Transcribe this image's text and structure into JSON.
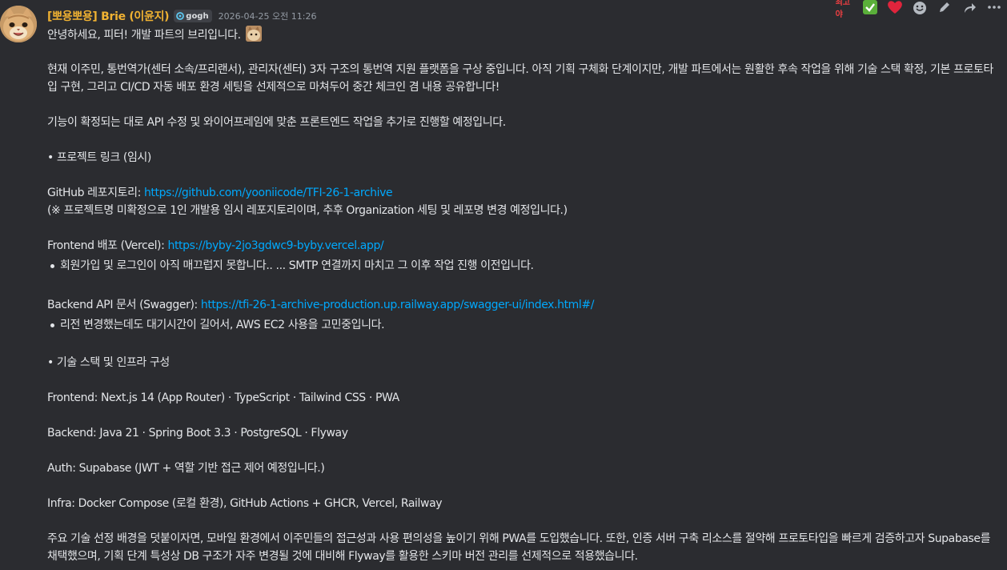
{
  "message": {
    "username": "[뽀용뽀용] Brie (이윤지)",
    "tag": "gogh",
    "timestamp": "2026-04-25 오전 11:26"
  },
  "toolbar": {
    "quick_react_text": "최고야",
    "icons": [
      "check-emoji",
      "heart-emoji",
      "add-reaction-icon",
      "edit-icon",
      "forward-icon",
      "more-icon"
    ]
  },
  "content": {
    "greeting": "안녕하세요, 피터! 개발 파트의 브리입니다.",
    "intro": "현재 이주민, 통번역가(센터 소속/프리랜서), 관리자(센터) 3자 구조의 통번역 지원 플랫폼을 구상 중입니다. 아직 기획 구체화 단계이지만, 개발 파트에서는 원활한 후속 작업을 위해 기술 스택 확정, 기본 프로토타입 구현, 그리고 CI/CD 자동 배포 환경 세팅을 선제적으로 마쳐두어 중간 체크인 겸 내용 공유합니다!",
    "plan": "기능이 확정되는 대로 API 수정 및 와이어프레임에 맞춘 프론트엔드 작업을 추가로 진행할 예정입니다.",
    "links_heading": "• 프로젝트 링크 (임시)",
    "github_label": "GitHub 레포지토리: ",
    "github_url": "https://github.com/yooniicode/TFI-26-1-archive",
    "github_note": "(※ 프로젝트명 미확정으로 1인 개발용 임시 레포지토리이며, 추후 Organization 세팅 및 레포명 변경 예정입니다.)",
    "frontend_label": "Frontend 배포 (Vercel): ",
    "frontend_url": "https://byby-2jo3gdwc9-byby.vercel.app/",
    "frontend_note": "회원가입 및 로그인이 아직 매끄럽지 못합니다.. ... SMTP 연결까지 마치고 그 이후 작업 진행 이전입니다.",
    "backend_label": "Backend API 문서 (Swagger): ",
    "backend_url": "https://tfi-26-1-archive-production.up.railway.app/swagger-ui/index.html#/",
    "backend_note": "리전 변경했는데도 대기시간이 길어서, AWS EC2 사용을 고민중입니다.",
    "stack_heading": "• 기술 스택 및 인프라 구성",
    "stack_frontend": "Frontend: Next.js 14 (App Router) · TypeScript · Tailwind CSS · PWA",
    "stack_backend": "Backend: Java 21 · Spring Boot 3.3 · PostgreSQL · Flyway",
    "stack_auth": "Auth: Supabase (JWT + 역할 기반 접근 제어 예정입니다.)",
    "stack_infra": "Infra: Docker Compose (로컬 환경), GitHub Actions + GHCR, Vercel, Railway",
    "rationale": "주요 기술 선정 배경을 덧붙이자면, 모바일 환경에서 이주민들의 접근성과 사용 편의성을 높이기 위해 PWA를 도입했습니다. 또한, 인증 서버 구축 리소스를 절약해 프로토타입을 빠르게 검증하고자 Supabase를 채택했으며, 기획 단계 특성상 DB 구조가 자주 변경될 것에 대비해 Flyway를 활용한 스키마 버전 관리를 선제적으로 적용했습니다."
  }
}
